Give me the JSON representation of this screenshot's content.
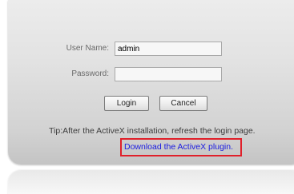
{
  "login_form": {
    "username_label": "User Name:",
    "username_value": "admin",
    "password_label": "Password:",
    "password_value": "",
    "login_button": "Login",
    "cancel_button": "Cancel"
  },
  "tip": {
    "text": "Tip:After the ActiveX installation, refresh the login page.",
    "download_link": "Download the ActiveX plugin."
  },
  "colors": {
    "link": "#1a1ae0",
    "highlight_border": "#e0202a",
    "panel": "#dcdcdc"
  }
}
